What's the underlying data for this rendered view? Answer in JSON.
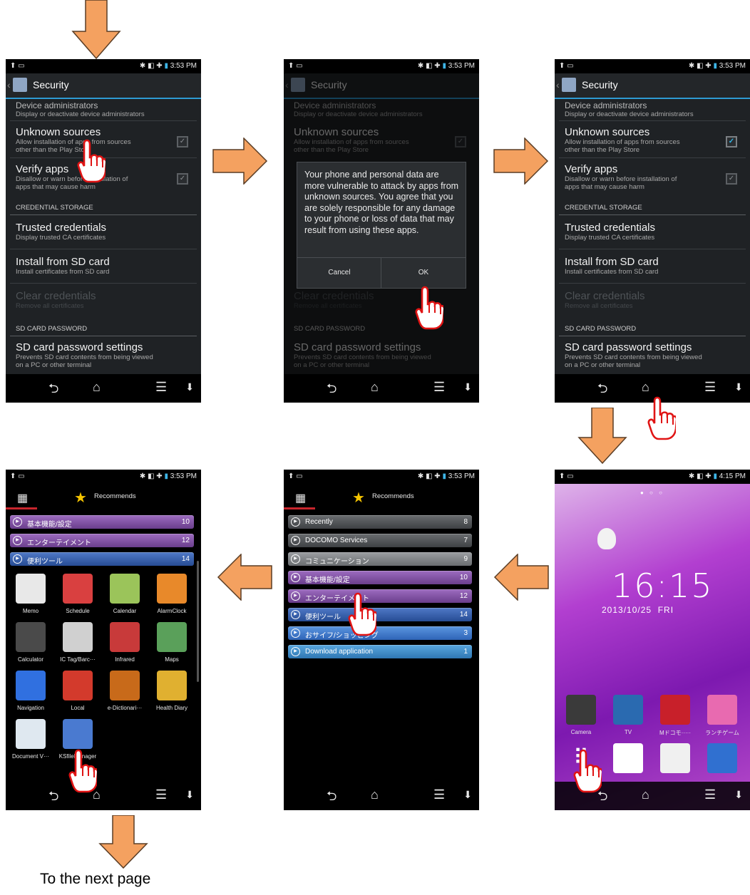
{
  "caption": "To the next page",
  "status_bar": {
    "left_icons": "⬆ ▭",
    "right_icons": "✱ ◧ ✚",
    "time1": "3:53 PM",
    "time2": "4:15 PM"
  },
  "security_screen": {
    "title": "Security",
    "top_cut_title": "Device administrators",
    "top_cut_sub": "Display or deactivate device administrators",
    "unknown_sources": {
      "title": "Unknown sources",
      "sub1": "Allow installation of apps from sources",
      "sub2": "other than the Play Store"
    },
    "verify_apps": {
      "title": "Verify apps",
      "sub1": "Disallow or warn before installation of",
      "sub2": "apps that may cause harm"
    },
    "credential_storage_header": "CREDENTIAL STORAGE",
    "trusted": {
      "title": "Trusted credentials",
      "sub": "Display trusted CA certificates"
    },
    "install": {
      "title": "Install from SD card",
      "sub": "Install certificates from SD card"
    },
    "clear": {
      "title": "Clear credentials",
      "sub": "Remove all certificates"
    },
    "sd_header": "SD CARD PASSWORD",
    "sd": {
      "title": "SD card password settings",
      "sub1": "Prevents SD card contents from being viewed",
      "sub2": "on a PC or other terminal"
    }
  },
  "dialog": {
    "message": "Your phone and personal data are more vulnerable to attack by apps from unknown sources. You agree that you are solely responsible for any damage to your phone or loss of data that may result from using these apps.",
    "cancel": "Cancel",
    "ok": "OK"
  },
  "app_drawer": {
    "tab_label": "Recommends",
    "categories_full": [
      {
        "name": "Recently",
        "count": "8",
        "color": "gray"
      },
      {
        "name": "DOCOMO Services",
        "count": "7",
        "color": "gray"
      },
      {
        "name": "コミュニケーション",
        "count": "9",
        "color": "lgray"
      },
      {
        "name": "基本機能/設定",
        "count": "10",
        "color": "purple"
      },
      {
        "name": "エンターテイメント",
        "count": "12",
        "color": "purple"
      },
      {
        "name": "便利ツール",
        "count": "14",
        "color": "blue"
      },
      {
        "name": "おサイフ/ショッピング",
        "count": "3",
        "color": "sky"
      },
      {
        "name": "Download application",
        "count": "1",
        "color": "teal"
      }
    ],
    "categories_expanded": [
      {
        "name": "基本機能/設定",
        "count": "10",
        "color": "purple"
      },
      {
        "name": "エンターテイメント",
        "count": "12",
        "color": "purple"
      },
      {
        "name": "便利ツール",
        "count": "14",
        "color": "blue"
      }
    ],
    "apps": [
      {
        "name": "Memo",
        "icon": "memo-icon",
        "color": "#e8e8e8"
      },
      {
        "name": "Schedule",
        "icon": "schedule-icon",
        "color": "#d94040"
      },
      {
        "name": "Calendar",
        "icon": "calendar-icon",
        "color": "#9bc45a"
      },
      {
        "name": "AlarmClock",
        "icon": "alarm-clock-icon",
        "color": "#e8892a"
      },
      {
        "name": "Calculator",
        "icon": "calculator-icon",
        "color": "#4a4a4a"
      },
      {
        "name": "IC Tag/Barc···",
        "icon": "barcode-icon",
        "color": "#d0d0d0"
      },
      {
        "name": "Infrared",
        "icon": "infrared-icon",
        "color": "#c83a3a"
      },
      {
        "name": "Maps",
        "icon": "maps-icon",
        "color": "#5aa05a"
      },
      {
        "name": "Navigation",
        "icon": "navigation-icon",
        "color": "#3070e0"
      },
      {
        "name": "Local",
        "icon": "local-icon",
        "color": "#d33a2c"
      },
      {
        "name": "e-Dictionari···",
        "icon": "dictionary-icon",
        "color": "#c86a1a"
      },
      {
        "name": "Health Diary",
        "icon": "health-diary-icon",
        "color": "#e0b030"
      },
      {
        "name": "Document V···",
        "icon": "document-viewer-icon",
        "color": "#dfe8f0"
      },
      {
        "name": "KSfileManager",
        "icon": "file-manager-icon",
        "color": "#4a7ad0"
      }
    ]
  },
  "home": {
    "time": "16:15",
    "date": "2013/10/25  FRI",
    "dock_top": [
      {
        "name": "Camera",
        "icon": "camera-icon",
        "color": "#3a3a3a"
      },
      {
        "name": "TV",
        "icon": "tv-icon",
        "color": "#2a6ab0"
      },
      {
        "name": "Mドコモ·····",
        "icon": "bookmark-icon",
        "color": "#c8202a"
      },
      {
        "name": "ランチゲーム",
        "icon": "game-icon",
        "color": "#e86ab0"
      }
    ],
    "dock_bottom": [
      {
        "icon": "apps-grid-icon",
        "color": "#00000000"
      },
      {
        "icon": "phone-icon",
        "color": "#ffffff"
      },
      {
        "icon": "mail-icon",
        "color": "#f0f0f0"
      },
      {
        "icon": "browser-icon",
        "color": "#3070d0"
      }
    ]
  }
}
